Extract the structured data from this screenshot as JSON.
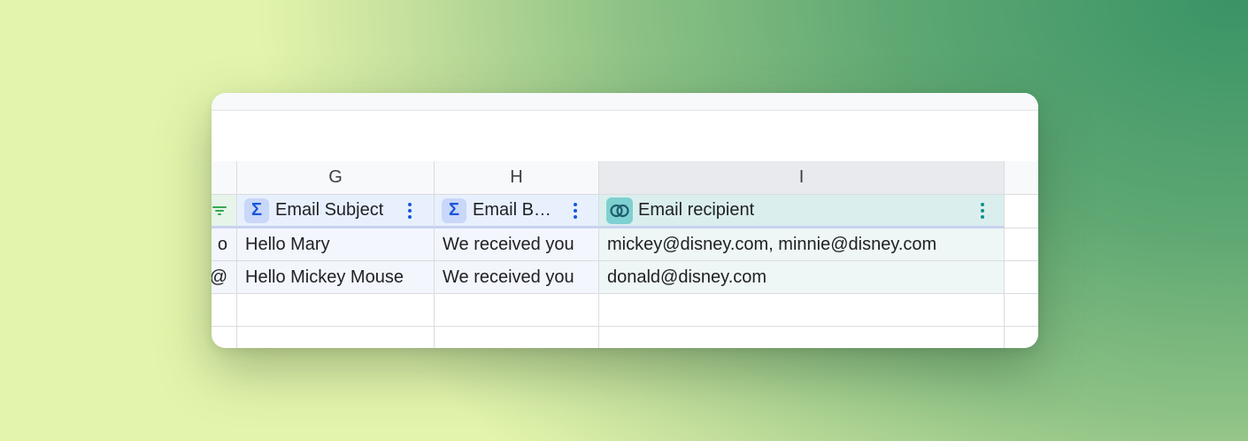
{
  "columns": {
    "g_letter": "G",
    "h_letter": "H",
    "i_letter": "I"
  },
  "headers": {
    "g": {
      "icon": "sigma-formula-icon",
      "label": "Email Subject"
    },
    "h": {
      "icon": "sigma-formula-icon",
      "label": "Email B…"
    },
    "i": {
      "icon": "linked-record-icon",
      "label": "Email recipient"
    },
    "prev": {
      "icon": "filter-lines-icon"
    }
  },
  "rows": [
    {
      "prev": "o",
      "subject": "Hello Mary",
      "body": "We received you",
      "recipient": "mickey@disney.com, minnie@disney.com"
    },
    {
      "prev": "@",
      "subject": "Hello Mickey Mouse",
      "body": "We received you",
      "recipient": "donald@disney.com"
    }
  ],
  "colors": {
    "formula_accent": "#1a56db",
    "link_accent": "#0f8f8f",
    "filter_accent": "#34a853"
  }
}
